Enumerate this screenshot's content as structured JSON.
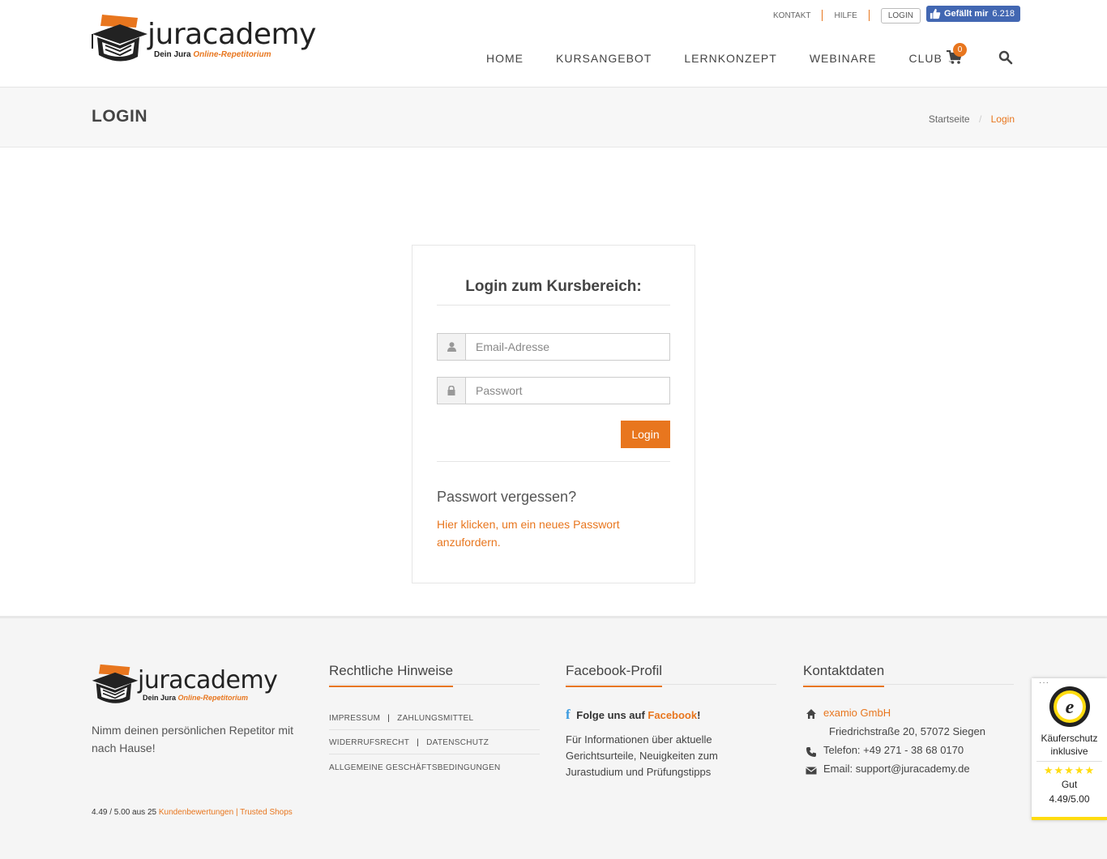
{
  "brand": {
    "name": "juracademy",
    "tagline_prefix": "Dein Jura",
    "tagline_highlight": "Online-Repetitorium"
  },
  "toplinks": {
    "kontakt": "KONTAKT",
    "hilfe": "HILFE",
    "login": "LOGIN"
  },
  "facebook_like": {
    "label": "Gefällt mir",
    "count": "6.218"
  },
  "nav": {
    "home": "HOME",
    "kursangebot": "KURSANGEBOT",
    "lernkonzept": "LERNKONZEPT",
    "webinare": "WEBINARE",
    "club": "CLUB",
    "cart_count": "0"
  },
  "titlebar": {
    "title": "LOGIN",
    "breadcrumb_home": "Startseite",
    "breadcrumb_sep": "/",
    "breadcrumb_current": "Login"
  },
  "login_form": {
    "heading": "Login zum Kursbereich:",
    "email_placeholder": "Email-Adresse",
    "password_placeholder": "Passwort",
    "submit_label": "Login",
    "forgot_heading": "Passwort vergessen?",
    "forgot_link": "Hier klicken, um ein neues Passwort anzufordern."
  },
  "footer": {
    "tagline": "Nimm deinen persönlichen Repetitor mit nach Hause!",
    "rating_prefix": "4.49 / 5.00 aus 25",
    "rating_link": "Kundenbewertungen | Trusted Shops",
    "legal": {
      "title": "Rechtliche Hinweise",
      "impressum": "IMPRESSUM",
      "zahlungsmittel": "ZAHLUNGSMITTEL",
      "widerrufsrecht": "WIDERRUFSRECHT",
      "datenschutz": "DATENSCHUTZ",
      "agb": "ALLGEMEINE GESCHÄFTSBEDINGUNGEN"
    },
    "facebook": {
      "title": "Facebook-Profil",
      "follow_prefix": "Folge uns auf",
      "follow_link": "Facebook",
      "follow_suffix": "!",
      "text": "Für Informationen über aktuelle Gerichtsurteile, Neuigkeiten zum Jurastudium und Prüfungstipps"
    },
    "contact": {
      "title": "Kontaktdaten",
      "company": "examio GmbH",
      "address": "Friedrichstraße 20, 57072 Siegen",
      "phone": "Telefon: +49 271 - 38 68 0170",
      "email": "Email: support@juracademy.de"
    }
  },
  "trusted_shops": {
    "protection": "Käuferschutz inklusive",
    "stars": "★★★★★",
    "grade": "Gut",
    "score": "4.49/5.00"
  },
  "colors": {
    "accent": "#e8761e",
    "facebook_blue": "#4267b2",
    "trusted_yellow": "#ffdc0f"
  }
}
